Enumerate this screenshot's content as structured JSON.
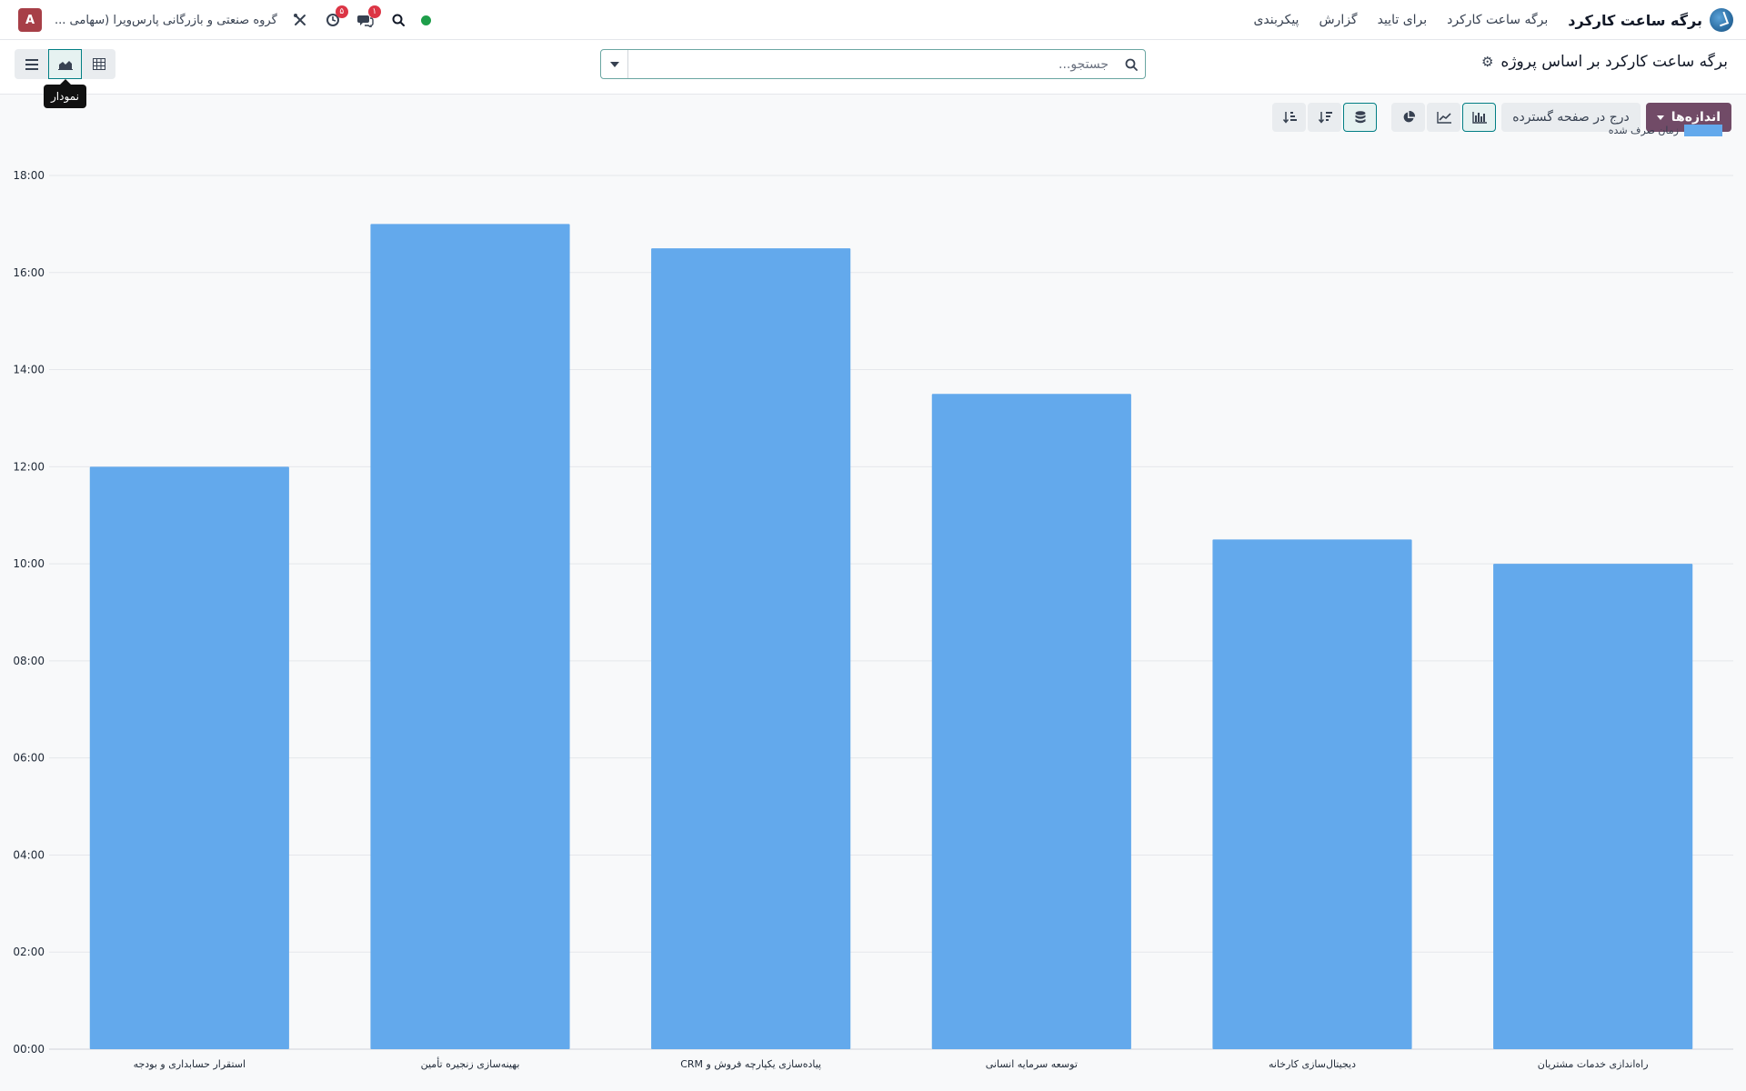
{
  "navbar": {
    "app_title": "برگه ساعت کارکرد",
    "menu": [
      "برگه ساعت کارکرد",
      "برای تایید",
      "گزارش",
      "پیکربندی"
    ],
    "company": "گروه صنعتی و بازرگانی پارس‌ویرا (سهامی ...",
    "avatar_letter": "A",
    "activity_badge": "۵",
    "chat_badge": "۱",
    "status_color": "#1e9e4a"
  },
  "control": {
    "page_title": "برگه ساعت کارکرد بر اساس پروژه",
    "search_placeholder": "جستجو...",
    "tooltip": "نمودار"
  },
  "toolbar": {
    "measures_label": "اندازه‌ها",
    "insert_label": "درج در صفحه گسترده"
  },
  "colors": {
    "accent": "#714b67",
    "active_border": "#017e84",
    "bar": "#63a9ec"
  },
  "chart_data": {
    "type": "bar",
    "categories": [
      "راه‌اندازی خدمات مشتریان",
      "دیجیتال‌سازی کارخانه",
      "توسعه سرمایه انسانی",
      "پیاده‌سازی یکپارچه فروش و CRM",
      "بهینه‌سازی زنجیره تأمین",
      "استقرار حسابداری و بودجه"
    ],
    "series": [
      {
        "name": "زمان صرف شده",
        "values": [
          10,
          10.5,
          13.5,
          16.5,
          17,
          12
        ]
      }
    ],
    "y_ticks": [
      "00:00",
      "02:00",
      "04:00",
      "06:00",
      "08:00",
      "10:00",
      "12:00",
      "14:00",
      "16:00",
      "18:00"
    ],
    "ylim": [
      0,
      18
    ],
    "legend": "top-right",
    "grid": true
  }
}
